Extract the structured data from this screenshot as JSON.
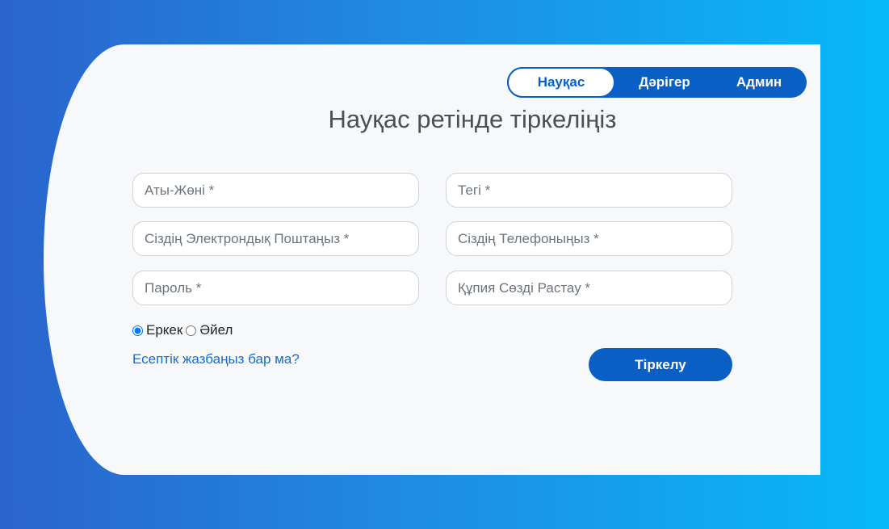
{
  "role_tabs": [
    {
      "label": "Науқас",
      "active": true
    },
    {
      "label": "Дәрігер",
      "active": false
    },
    {
      "label": "Админ",
      "active": false
    }
  ],
  "heading": "Науқас ретінде тіркеліңіз",
  "form": {
    "first_name_placeholder": "Аты-Жөні *",
    "last_name_placeholder": "Тегі *",
    "email_placeholder": "Сіздің Электрондық Поштаңыз *",
    "phone_placeholder": "Сіздің Телефоныңыз *",
    "password_placeholder": "Пароль *",
    "confirm_password_placeholder": "Құпия Сөзді Растау *",
    "gender": {
      "options": [
        "Еркек",
        "Әйел"
      ],
      "selected": "Еркек"
    },
    "login_link": "Есептік жазбаңыз бар ма?",
    "submit_label": "Тіркелу"
  },
  "colors": {
    "accent": "#0a5fc5",
    "link": "#0d6fd1",
    "background_gradient_start": "#2a64cc",
    "background_gradient_end": "#07b9f7",
    "card": "#f6f8fa"
  }
}
